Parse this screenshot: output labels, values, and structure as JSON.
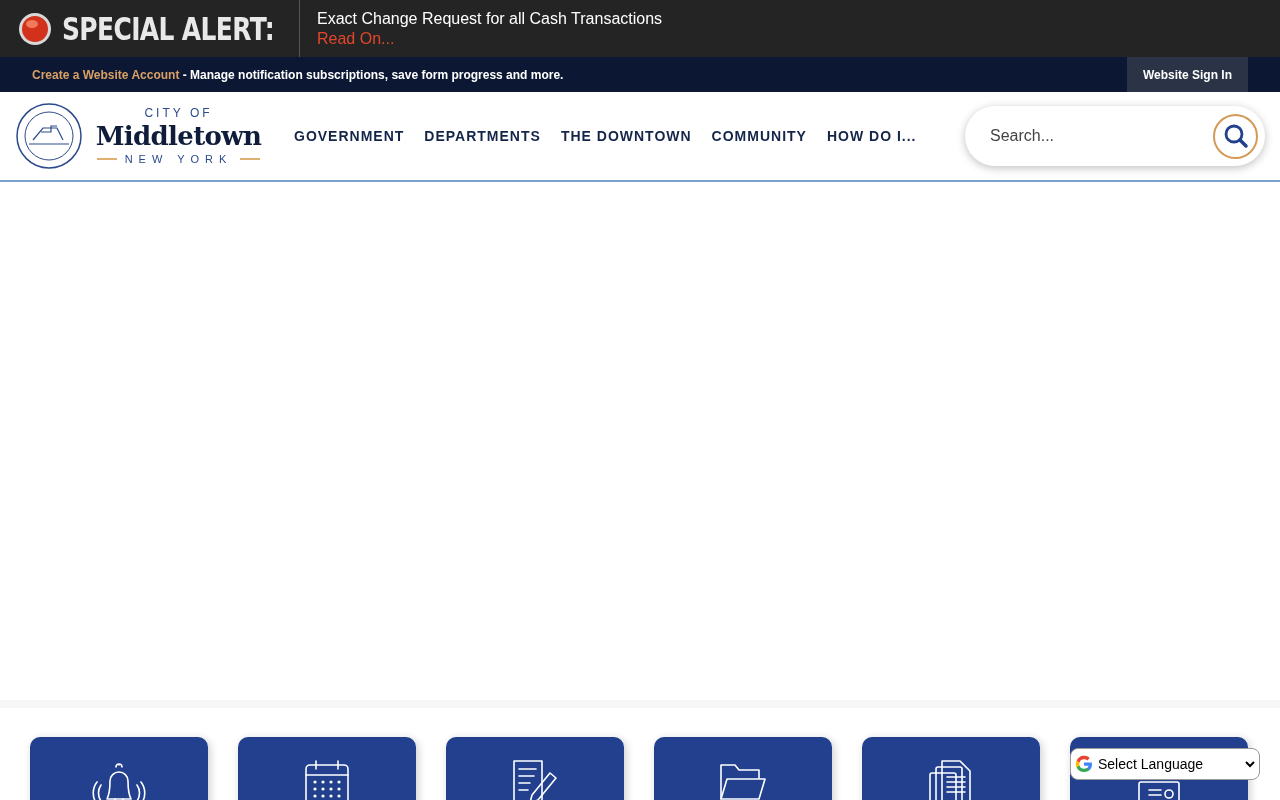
{
  "alert": {
    "label": "SPECIAL ALERT:",
    "message": "Exact Change Request for all Cash Transactions",
    "link": "Read On..."
  },
  "account_bar": {
    "link": "Create a Website Account",
    "text": " - Manage notification subscriptions, save form progress and more.",
    "sign_in": "Website Sign In"
  },
  "logo": {
    "top": "CITY OF",
    "name": "Middletown",
    "bottom": "NEW YORK"
  },
  "nav": [
    "GOVERNMENT",
    "DEPARTMENTS",
    "THE DOWNTOWN",
    "COMMUNITY",
    "HOW DO I..."
  ],
  "search": {
    "placeholder": "Search..."
  },
  "tiles": [
    {
      "kind": "bell"
    },
    {
      "kind": "calendar"
    },
    {
      "kind": "form"
    },
    {
      "kind": "folder"
    },
    {
      "kind": "documents"
    },
    {
      "kind": "payment"
    }
  ],
  "language": {
    "value": "Select Language"
  }
}
